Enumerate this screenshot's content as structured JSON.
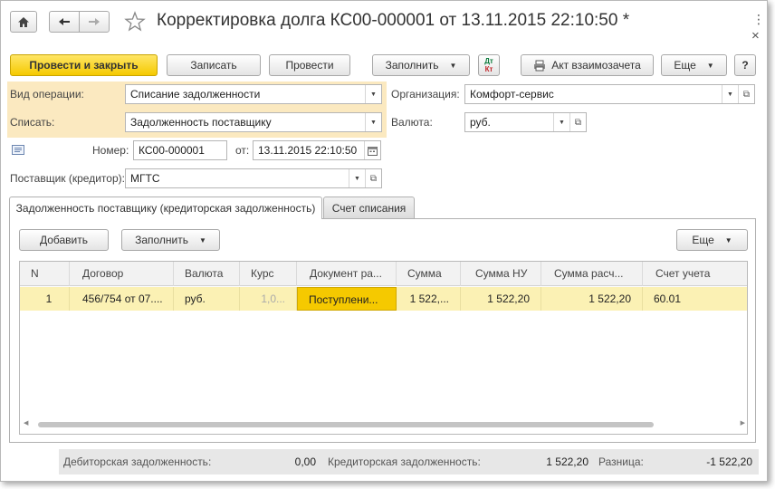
{
  "window": {
    "title": "Корректировка долга КС00-000001 от 13.11.2015 22:10:50 *",
    "more_glyph": "⋮",
    "close_glyph": "×"
  },
  "toolbar": {
    "post_close_label": "Провести и закрыть",
    "save_label": "Записать",
    "post_label": "Провести",
    "fill_label": "Заполнить",
    "act_label": "Акт взаимозачета",
    "more_label": "Еще",
    "help_label": "?",
    "dtkt_top": "Дт",
    "dtkt_bottom": "Кт"
  },
  "form": {
    "operation_label": "Вид операции:",
    "operation_value": "Списание задолженности",
    "writeoff_label": "Списать:",
    "writeoff_value": "Задолженность поставщику",
    "number_label": "Номер:",
    "number_value": "КС00-000001",
    "date_label": "от:",
    "date_value": "13.11.2015 22:10:50",
    "supplier_label": "Поставщик (кредитор):",
    "supplier_value": "МГТС",
    "org_label": "Организация:",
    "org_value": "Комфорт-сервис",
    "currency_label": "Валюта:",
    "currency_value": "руб."
  },
  "tabs": [
    {
      "label": "Задолженность поставщику (кредиторская задолженность)",
      "active": true
    },
    {
      "label": "Счет списания",
      "active": false
    }
  ],
  "table_toolbar": {
    "add_label": "Добавить",
    "fill_label": "Заполнить",
    "more_label": "Еще"
  },
  "table": {
    "columns": [
      "N",
      "Договор",
      "Валюта",
      "Курс",
      "Документ ра...",
      "Сумма",
      "Сумма НУ",
      "Сумма расч...",
      "Счет учета"
    ],
    "rows": [
      [
        "1",
        "456/754 от 07....",
        "руб.",
        "1,0...",
        "Поступлени...",
        "1 522,...",
        "1 522,20",
        "1 522,20",
        "60.01"
      ]
    ]
  },
  "footer": {
    "debit_label": "Дебиторская задолженность:",
    "debit_value": "0,00",
    "credit_label": "Кредиторская задолженность:",
    "credit_value": "1 522,20",
    "diff_label": "Разница:",
    "diff_value": "-1 522,20"
  },
  "colors": {
    "accent": "#f5c900",
    "row_highlight": "#fbf1b4",
    "required_highlight": "#fbe9c0"
  }
}
